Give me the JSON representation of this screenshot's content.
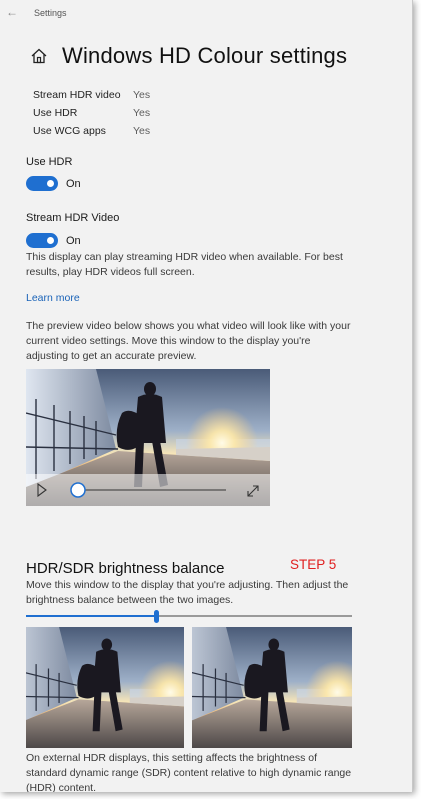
{
  "titlebar": {
    "back_icon": "back-arrow-icon",
    "title": "Settings"
  },
  "page": {
    "home_icon": "home-icon",
    "title": "Windows HD Colour settings"
  },
  "display_info": [
    {
      "label": "Stream HDR video",
      "value": "Yes"
    },
    {
      "label": "Use HDR",
      "value": "Yes"
    },
    {
      "label": "Use WCG apps",
      "value": "Yes"
    }
  ],
  "use_hdr": {
    "label": "Use HDR",
    "state": "On",
    "on": true
  },
  "stream_hdr": {
    "label": "Stream HDR Video",
    "state": "On",
    "on": true,
    "description": "This display can play streaming HDR video when available. For best results, play HDR videos full screen."
  },
  "learn_more": "Learn more",
  "preview": {
    "intro": "The preview video below shows you what video will look like with your current video settings. Move this window to the display you're adjusting to get an accurate preview.",
    "play_icon": "play-icon",
    "expand_icon": "expand-icon",
    "progress": 0.0
  },
  "brightness_balance": {
    "heading": "HDR/SDR brightness balance",
    "step_label": "STEP 5",
    "instruction": "Move this window to the display that you're adjusting. Then adjust the brightness balance between the two images.",
    "slider_value": 0.4,
    "footnote": "On external HDR displays, this setting affects the brightness of standard dynamic range (SDR) content relative to high dynamic range (HDR) content."
  },
  "colors": {
    "accent": "#1f6fd0",
    "step_label": "#e02020",
    "link": "#1a63b8"
  }
}
